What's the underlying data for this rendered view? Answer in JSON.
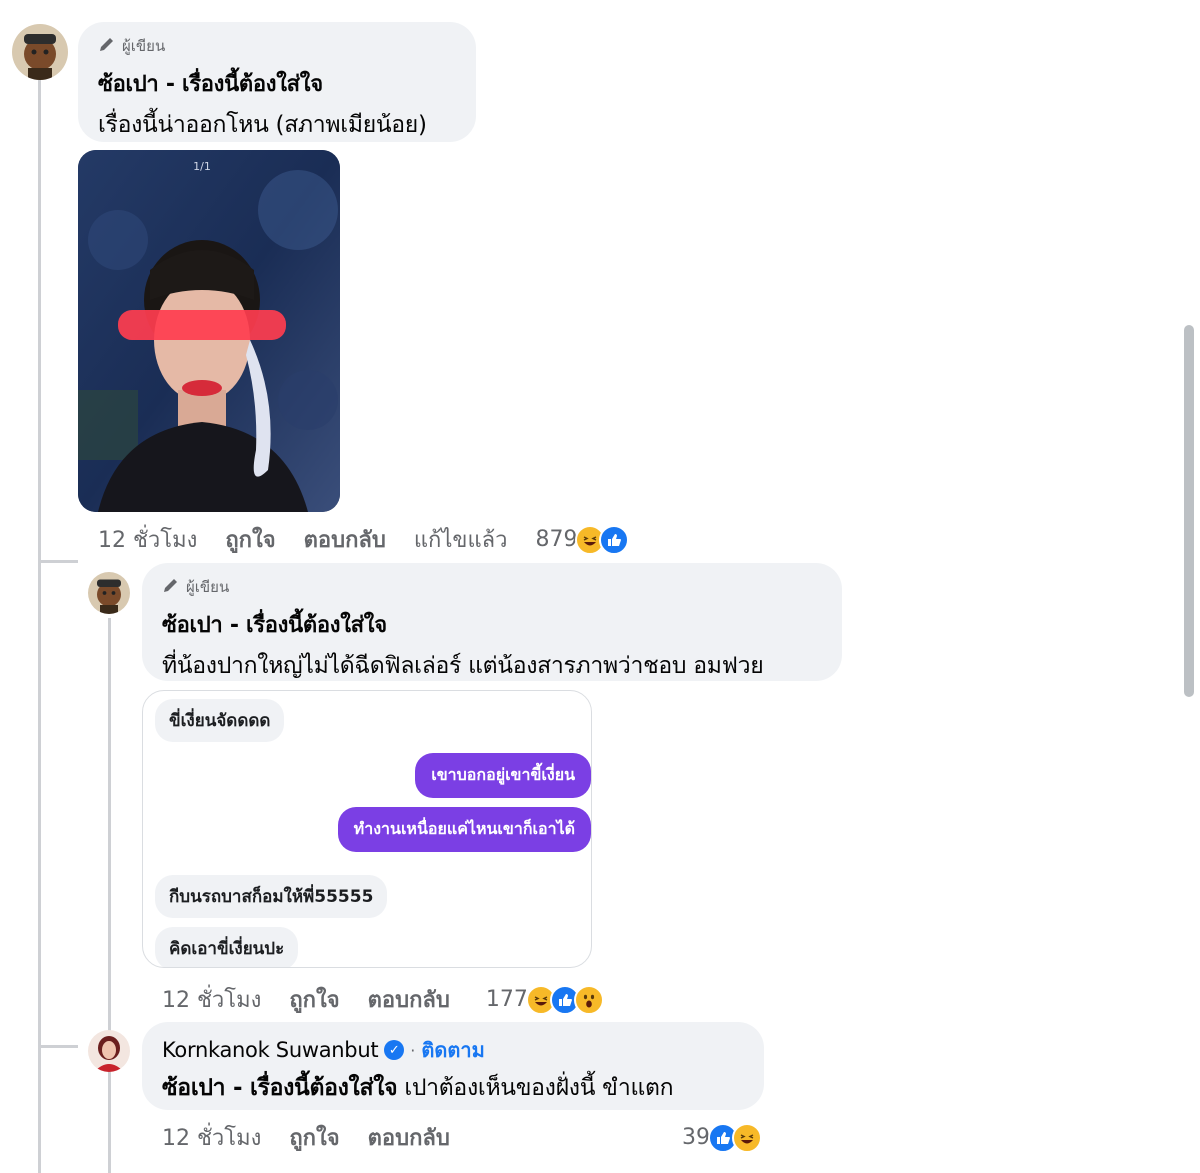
{
  "comments": [
    {
      "author_tag": "ผู้เขียน",
      "author": "ซ้อเปา - เรื่องนี้ต้องใส่ใจ",
      "text": "เรื่องนี้น่าออกโหน (สภาพเมียน้อย)",
      "photo_counter": "1/1",
      "time": "12 ชั่วโมง",
      "like_label": "ถูกใจ",
      "reply_label": "ตอบกลับ",
      "edited_label": "แก้ไขแล้ว",
      "reaction_count": "879"
    },
    {
      "author_tag": "ผู้เขียน",
      "author": "ซ้อเปา - เรื่องนี้ต้องใส่ใจ",
      "text": "ที่น้องปากใหญ่ไม่ได้ฉีดฟิลเล่อร์ แต่น้องสารภาพว่าชอบ อมฟวย",
      "chat": {
        "msg1": "ขี่เงี่ยนจัดดดด",
        "msg2": "เขาบอกอยู่เขาขี้เงี่ยน",
        "msg3": "ทำงานเหนื่อยแค่ไหนเขาก็เอาได้",
        "msg4": "กีบนรถบาสก็อมให้พี่55555",
        "msg5": "คิดเอาขี่เงี่ยนปะ"
      },
      "time": "12 ชั่วโมง",
      "like_label": "ถูกใจ",
      "reply_label": "ตอบกลับ",
      "reaction_count": "177"
    },
    {
      "author": "Kornkanok Suwanbut",
      "follow_label": "ติดตาม",
      "mention": "ซ้อเปา - เรื่องนี้ต้องใส่ใจ",
      "text": " เปาต้องเห็นของฝั่งนี้ ขำแตก",
      "time": "12 ชั่วโมง",
      "like_label": "ถูกใจ",
      "reply_label": "ตอบกลับ",
      "reaction_count": "39"
    }
  ],
  "colors": {
    "bubble": "#f0f2f5",
    "link_blue": "#1877f2",
    "chat_purple": "#7b3fe4",
    "muted": "#65676b"
  },
  "icons": [
    "pencil-icon",
    "verified-badge-icon",
    "haha-reaction-icon",
    "like-reaction-icon",
    "wow-reaction-icon"
  ]
}
